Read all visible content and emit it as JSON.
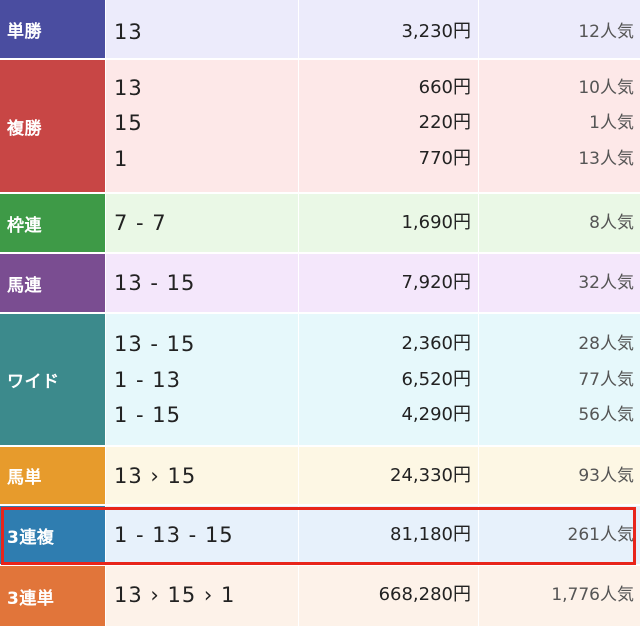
{
  "colors": {
    "highlight": "#e8251b"
  },
  "rows": [
    {
      "label": "単勝",
      "label_color": "#4a4da0",
      "bg": "#ecebfb",
      "entries": [
        {
          "combo": "13",
          "payout": "3,230円",
          "popularity": "12人気"
        }
      ]
    },
    {
      "label": "複勝",
      "label_color": "#c84645",
      "bg": "#fde8e8",
      "entries": [
        {
          "combo": "13",
          "payout": "660円",
          "popularity": "10人気"
        },
        {
          "combo": "15",
          "payout": "220円",
          "popularity": "1人気"
        },
        {
          "combo": "1",
          "payout": "770円",
          "popularity": "13人気"
        }
      ]
    },
    {
      "label": "枠連",
      "label_color": "#3e9a47",
      "bg": "#eaf8e6",
      "entries": [
        {
          "combo": "7 - 7",
          "payout": "1,690円",
          "popularity": "8人気"
        }
      ]
    },
    {
      "label": "馬連",
      "label_color": "#7a4d91",
      "bg": "#f4e7fb",
      "entries": [
        {
          "combo": "13 - 15",
          "payout": "7,920円",
          "popularity": "32人気"
        }
      ]
    },
    {
      "label": "ワイド",
      "label_color": "#3c8a8c",
      "bg": "#e6f8fb",
      "entries": [
        {
          "combo": "13 - 15",
          "payout": "2,360円",
          "popularity": "28人気"
        },
        {
          "combo": "1 - 13",
          "payout": "6,520円",
          "popularity": "77人気"
        },
        {
          "combo": "1 - 15",
          "payout": "4,290円",
          "popularity": "56人気"
        }
      ]
    },
    {
      "label": "馬単",
      "label_color": "#e79b2c",
      "bg": "#fdf7e4",
      "entries": [
        {
          "combo": "13 › 15",
          "payout": "24,330円",
          "popularity": "93人気"
        }
      ]
    },
    {
      "label": "3連複",
      "label_color": "#2f7db0",
      "bg": "#e7f1fb",
      "highlighted": true,
      "entries": [
        {
          "combo": "1 - 13 - 15",
          "payout": "81,180円",
          "popularity": "261人気"
        }
      ]
    },
    {
      "label": "3連単",
      "label_color": "#e1753a",
      "bg": "#fdf2e9",
      "entries": [
        {
          "combo": "13 › 15 › 1",
          "payout": "668,280円",
          "popularity": "1,776人気"
        }
      ]
    }
  ]
}
